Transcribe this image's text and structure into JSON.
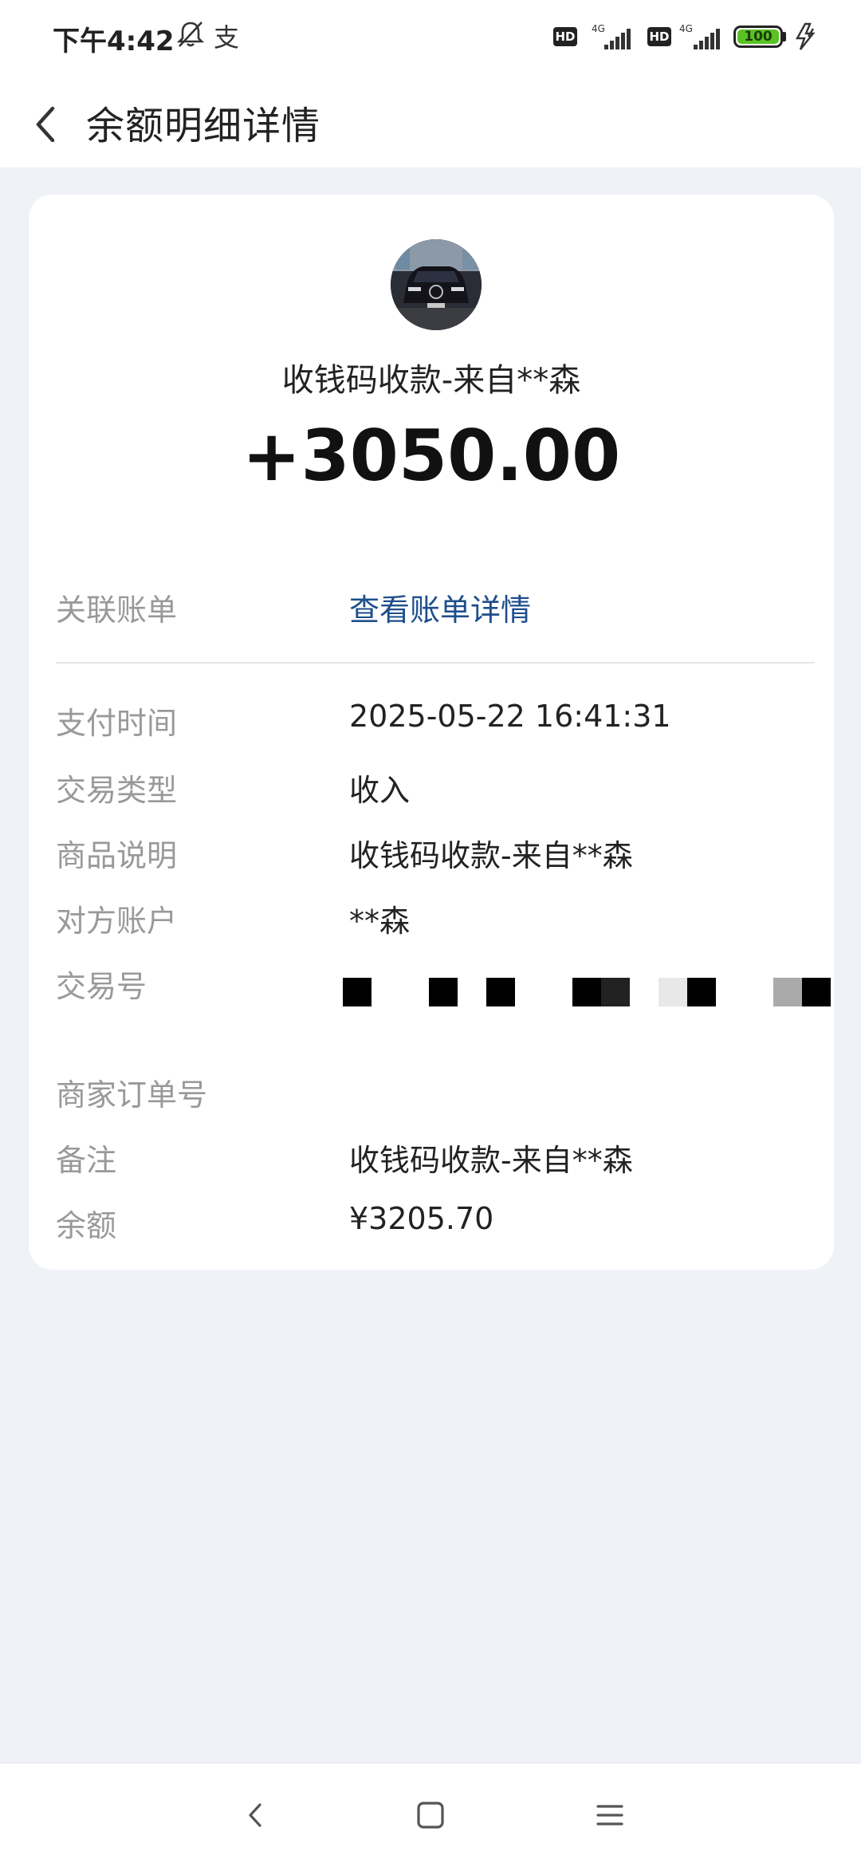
{
  "status_bar": {
    "time": "下午4:42",
    "network_1": "4G",
    "network_2": "4G",
    "hd_1": "HD",
    "hd_2": "HD",
    "battery": "100",
    "alipay_icon_glyph": "支"
  },
  "header": {
    "title": "余额明细详情"
  },
  "transaction": {
    "payee": "收钱码收款-来自**森",
    "amount": "+3050.00"
  },
  "details": {
    "related_bill_label": "关联账单",
    "related_bill_link": "查看账单详情",
    "pay_time_label": "支付时间",
    "pay_time_value": "2025-05-22 16:41:31",
    "type_label": "交易类型",
    "type_value": "收入",
    "desc_label": "商品说明",
    "desc_value": "收钱码收款-来自**森",
    "counterparty_label": "对方账户",
    "counterparty_value": "**森",
    "txn_no_label": "交易号",
    "merchant_order_label": "商家订单号",
    "remark_label": "备注",
    "remark_value": "收钱码收款-来自**森",
    "balance_label": "余额",
    "balance_value": "¥3205.70"
  },
  "colors": {
    "link": "#1e4e8c",
    "background": "#eff2f7",
    "battery": "#58c322"
  }
}
